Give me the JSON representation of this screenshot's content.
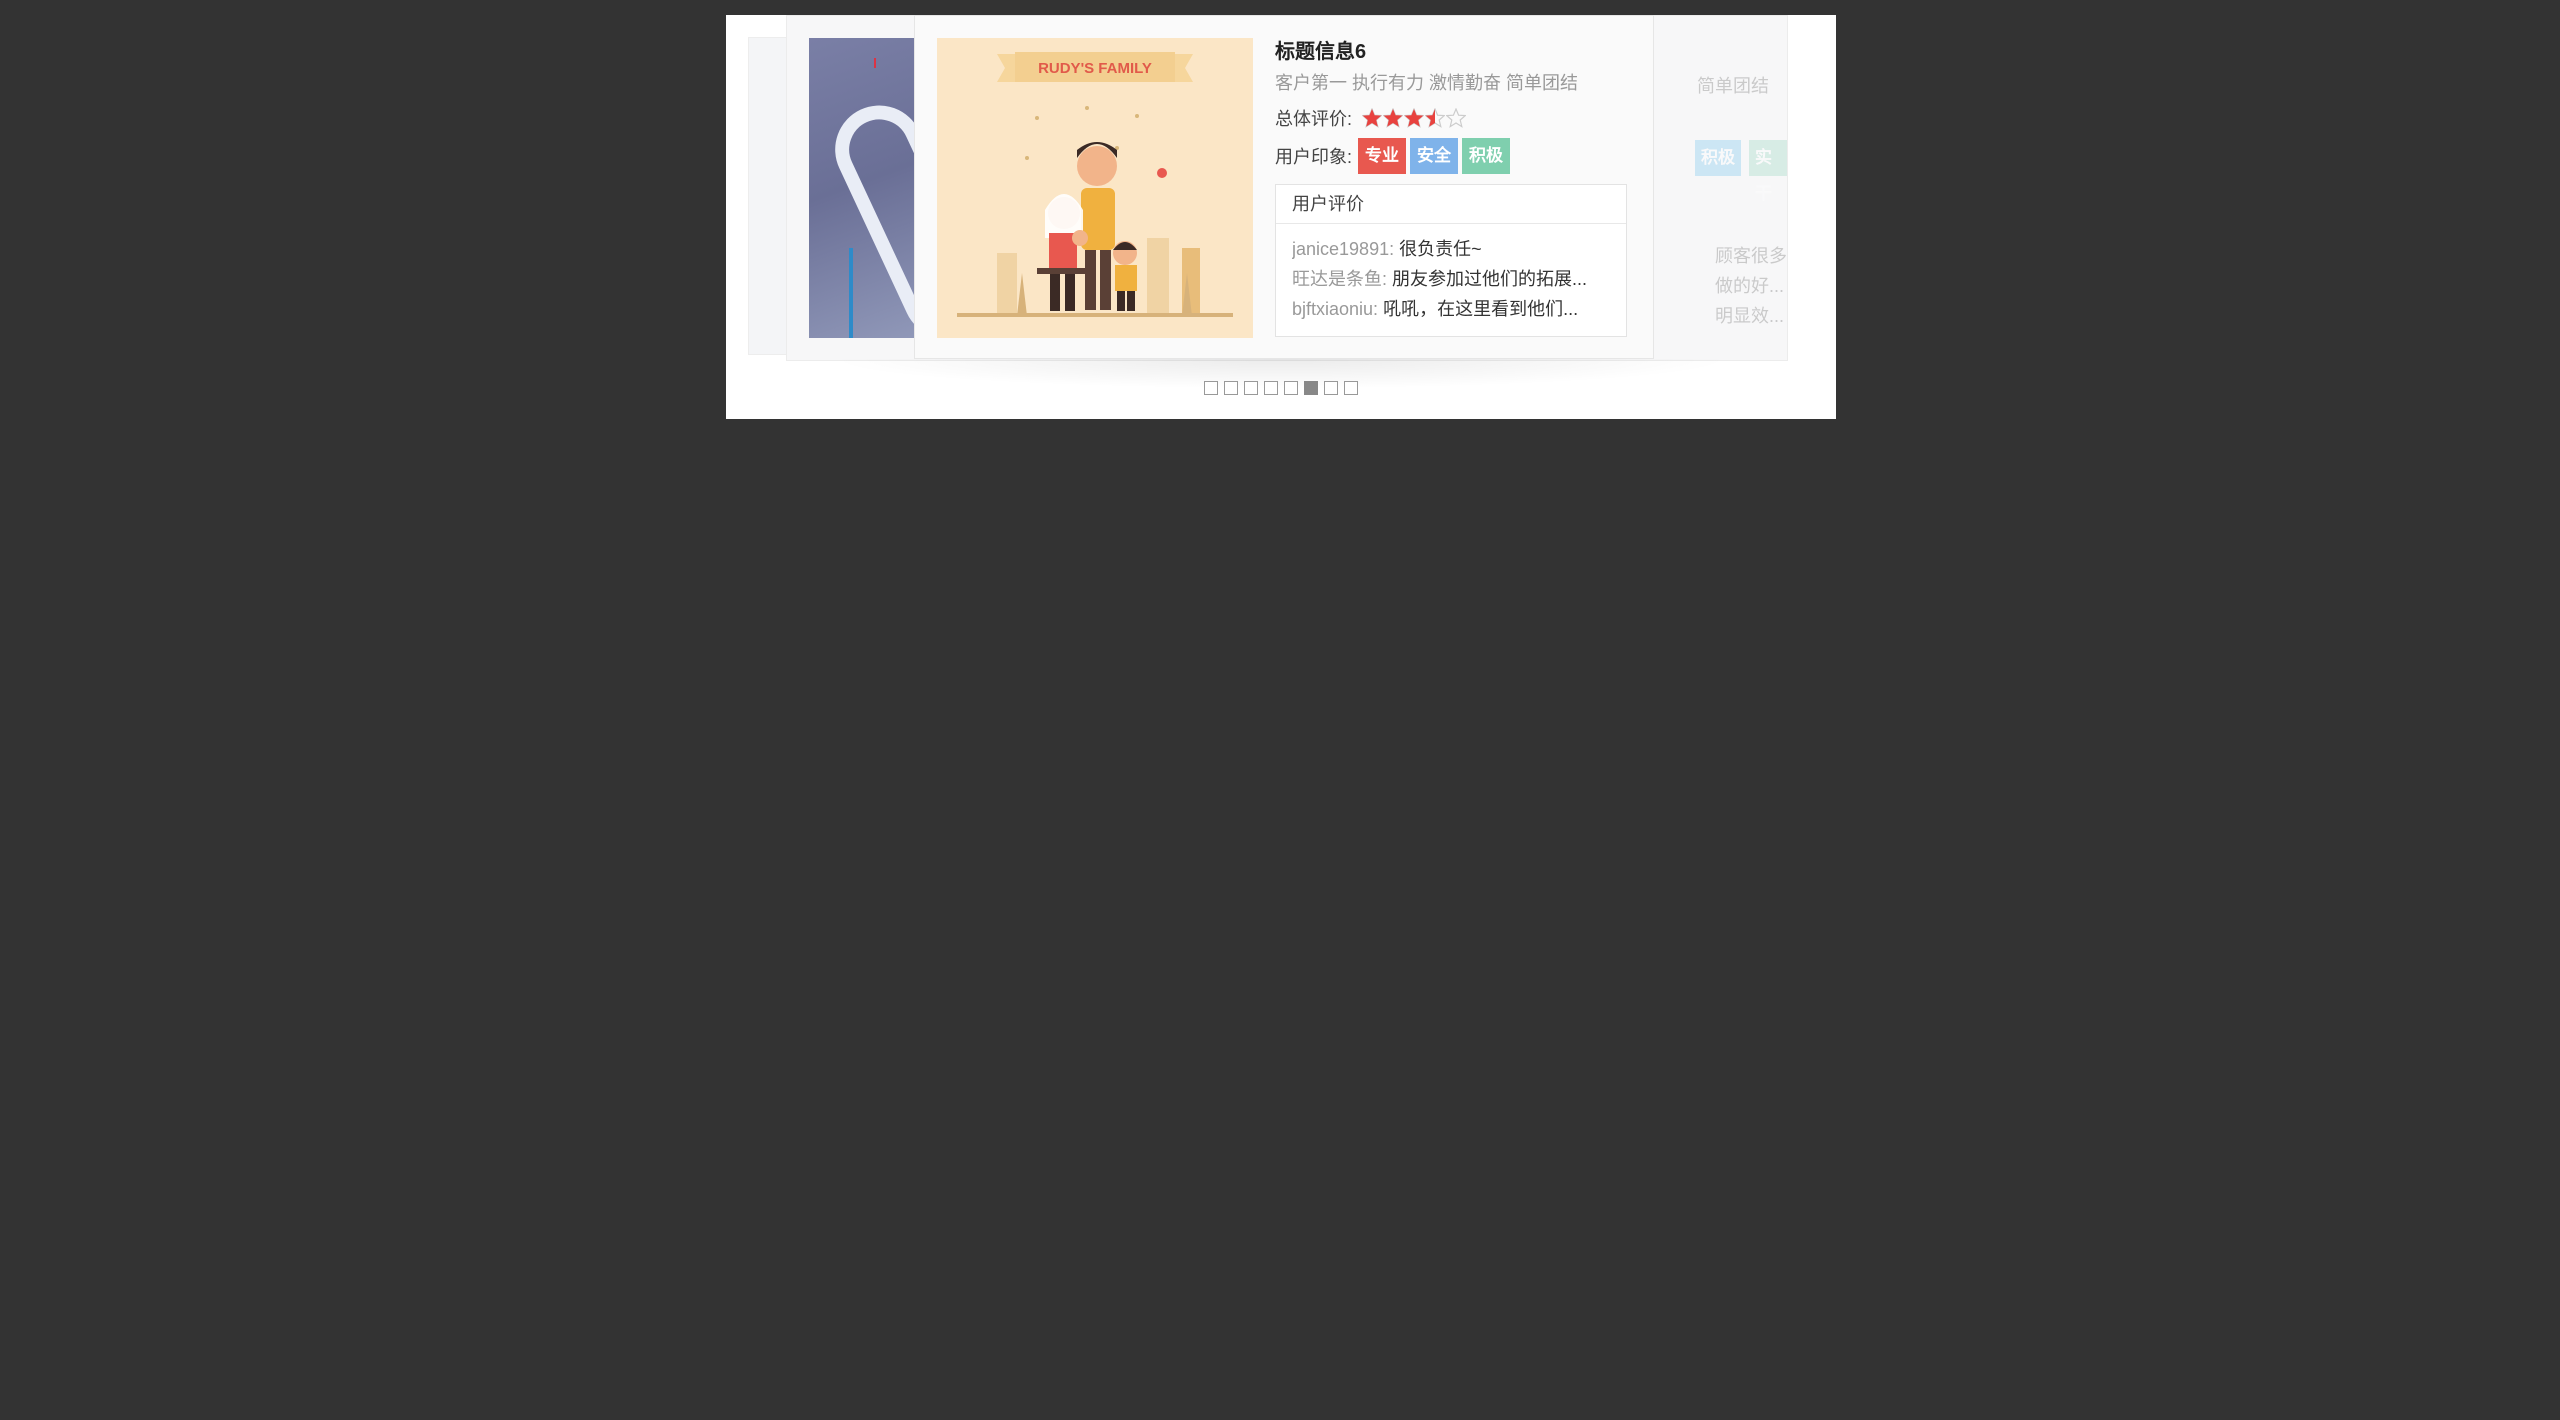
{
  "carousel": {
    "back_card_right": {
      "subtitle_fragment": "简单团结",
      "tags": [
        {
          "label": "积极",
          "color": "#7ec7ef"
        },
        {
          "label": "实干",
          "color": "#9ed9c4"
        }
      ],
      "reviews": [
        "顾客很多...",
        "做的好...",
        "明显效..."
      ]
    },
    "card": {
      "title": "标题信息6",
      "subtitle": "客户第一 执行有力 激情勤奋 简单团结",
      "rating_label": "总体评价:",
      "rating_value": 3.5,
      "rating_max": 5,
      "impression_label": "用户印象:",
      "tags": [
        {
          "label": "专业",
          "color": "#e8584f"
        },
        {
          "label": "安全",
          "color": "#7fb3ea"
        },
        {
          "label": "积极",
          "color": "#7fcfae"
        }
      ],
      "reviews_header": "用户评价",
      "reviews": [
        {
          "user": "janice19891:",
          "text": "很负责任~"
        },
        {
          "user": "旺达是条鱼:",
          "text": "朋友参加过他们的拓展..."
        },
        {
          "user": "bjftxiaoniu:",
          "text": "吼吼，在这里看到他们..."
        }
      ],
      "image_caption": "RUDY'S FAMILY"
    },
    "pagination": {
      "total": 8,
      "active_index": 5
    }
  },
  "colors": {
    "background": "#333333",
    "star_filled": "#e8423f",
    "star_empty": "#cccccc"
  }
}
